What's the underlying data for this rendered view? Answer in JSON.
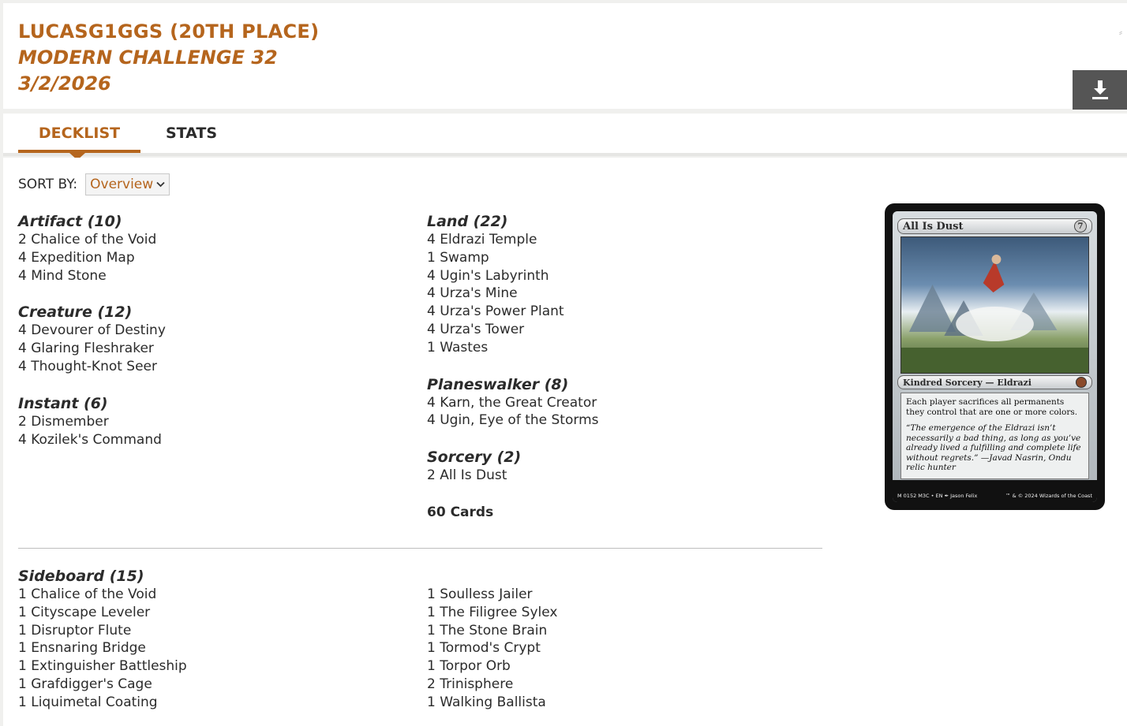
{
  "header": {
    "player": "LUCASG1GGS (20TH PLACE)",
    "event": "MODERN CHALLENGE 32",
    "date": "3/2/2026"
  },
  "tabs": {
    "decklist": "DECKLIST",
    "stats": "STATS"
  },
  "sort": {
    "label": "SORT BY:",
    "selected": "Overview"
  },
  "mainboard": {
    "left": [
      {
        "title": "Artifact (10)",
        "cards": [
          "2 Chalice of the Void",
          "4 Expedition Map",
          "4 Mind Stone"
        ]
      },
      {
        "title": "Creature (12)",
        "cards": [
          "4 Devourer of Destiny",
          "4 Glaring Fleshraker",
          "4 Thought-Knot Seer"
        ]
      },
      {
        "title": "Instant (6)",
        "cards": [
          "2 Dismember",
          "4 Kozilek's Command"
        ]
      }
    ],
    "right": [
      {
        "title": "Land (22)",
        "cards": [
          "4 Eldrazi Temple",
          "1 Swamp",
          "4 Ugin's Labyrinth",
          "4 Urza's Mine",
          "4 Urza's Power Plant",
          "4 Urza's Tower",
          "1 Wastes"
        ]
      },
      {
        "title": "Planeswalker (8)",
        "cards": [
          "4 Karn, the Great Creator",
          "4 Ugin, Eye of the Storms"
        ]
      },
      {
        "title": "Sorcery (2)",
        "cards": [
          "2 All Is Dust"
        ]
      }
    ],
    "total": "60 Cards"
  },
  "sideboard": {
    "title": "Sideboard (15)",
    "left": [
      "1 Chalice of the Void",
      "1 Cityscape Leveler",
      "1 Disruptor Flute",
      "1 Ensnaring Bridge",
      "1 Extinguisher Battleship",
      "1 Grafdigger's Cage",
      "1 Liquimetal Coating"
    ],
    "right": [
      "1 Soulless Jailer",
      "1 The Filigree Sylex",
      "1 The Stone Brain",
      "1 Tormod's Crypt",
      "1 Torpor Orb",
      "2 Trinisphere",
      "1 Walking Ballista"
    ]
  },
  "card_preview": {
    "name": "All Is Dust",
    "cost": "7",
    "type_line": "Kindred Sorcery — Eldrazi",
    "rules_text": "Each player sacrifices all permanents they control that are one or more colors.",
    "flavor_text": "“The emergence of the Eldrazi isn’t necessarily a bad thing, as long as you’ve already lived a fulfilling and complete life without regrets.” —Javad Nasrin, Ondu relic hunter",
    "footer_left": "M 0152 M3C • EN ✒ Jason Felix",
    "footer_right": "™ & © 2024 Wizards of the Coast"
  },
  "colors": {
    "accent": "#b5651d",
    "download_bg": "#555555"
  },
  "icons": {
    "download": "download-icon",
    "chevron": "chevron-down-icon"
  }
}
